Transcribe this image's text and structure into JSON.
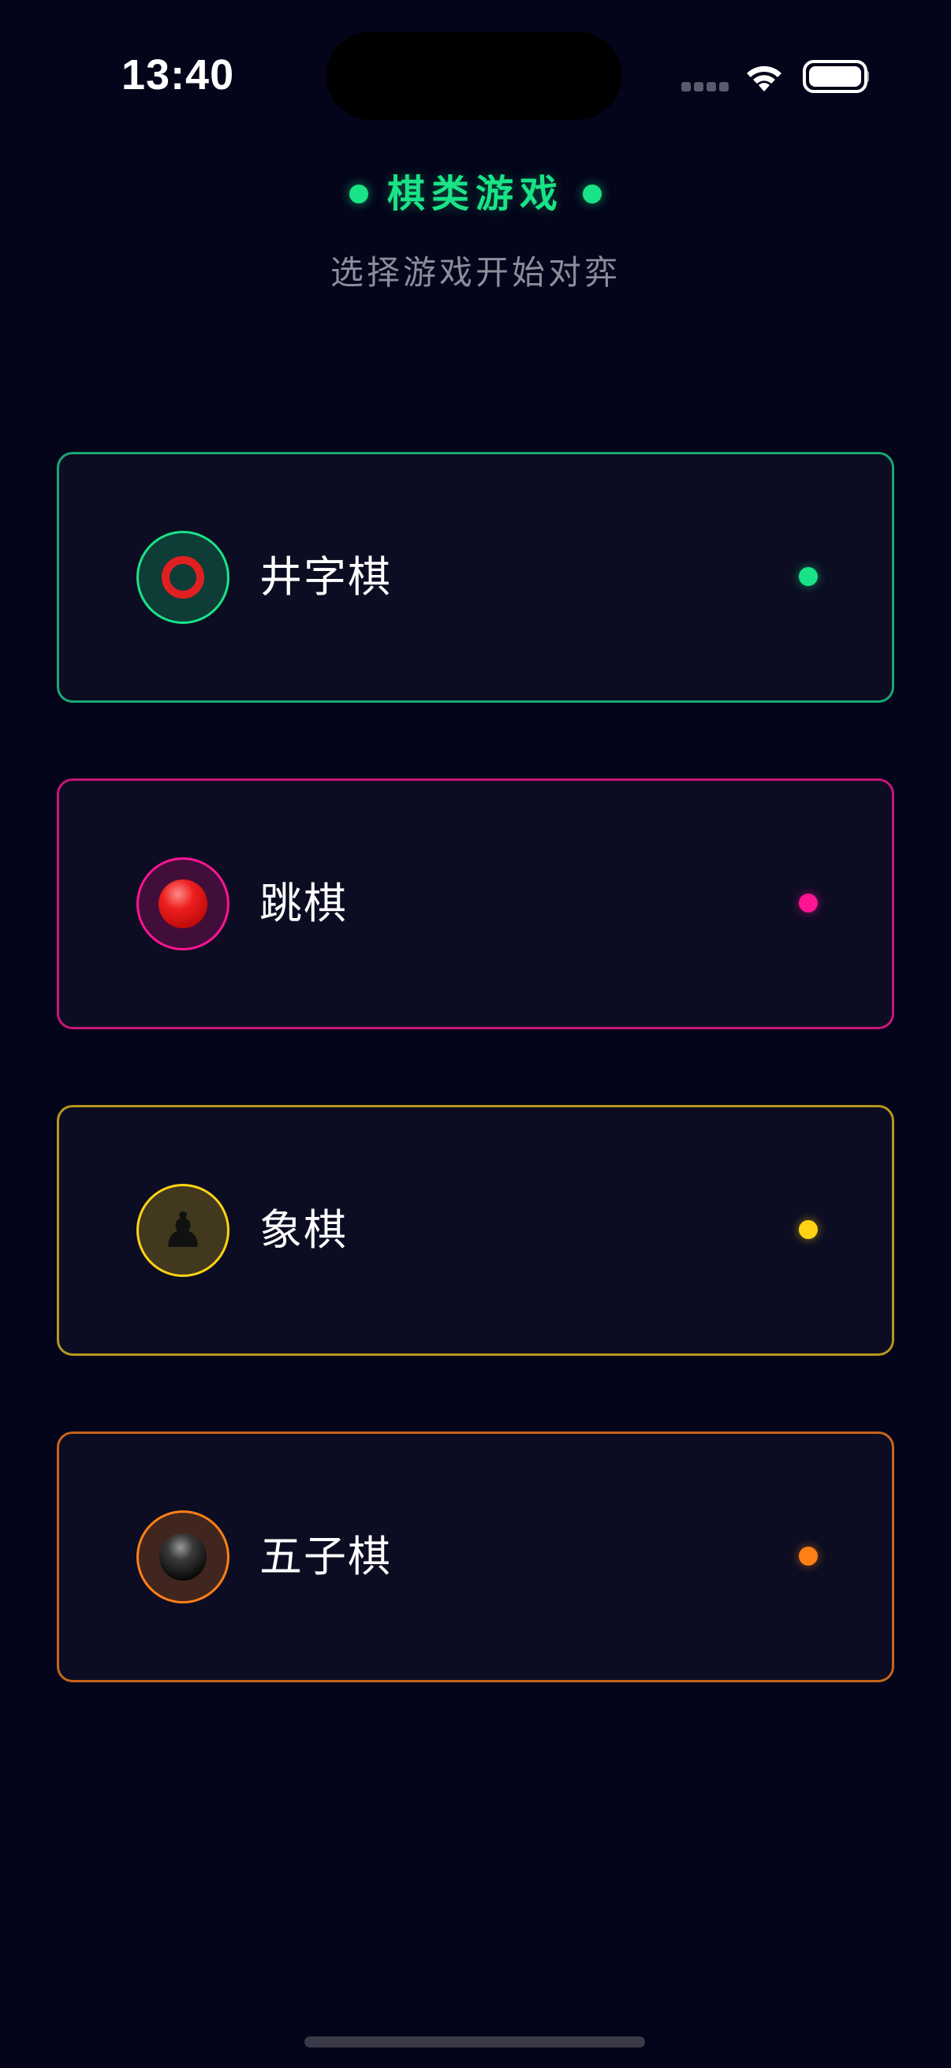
{
  "status_bar": {
    "time": "13:40"
  },
  "header": {
    "title": "棋类游戏",
    "subtitle": "选择游戏开始对弈",
    "accent_color": "#19e386"
  },
  "games": [
    {
      "label": "井字棋",
      "icon": "red-ring-icon",
      "accent_color": "#18a774",
      "dot_color": "#19e386"
    },
    {
      "label": "跳棋",
      "icon": "red-ball-icon",
      "accent_color": "#c8167a",
      "dot_color": "#ff1493"
    },
    {
      "label": "象棋",
      "icon": "chess-pawn-icon",
      "accent_color": "#b8961e",
      "dot_color": "#ffd313"
    },
    {
      "label": "五子棋",
      "icon": "black-stone-icon",
      "accent_color": "#c8651a",
      "dot_color": "#ff7f16"
    }
  ]
}
